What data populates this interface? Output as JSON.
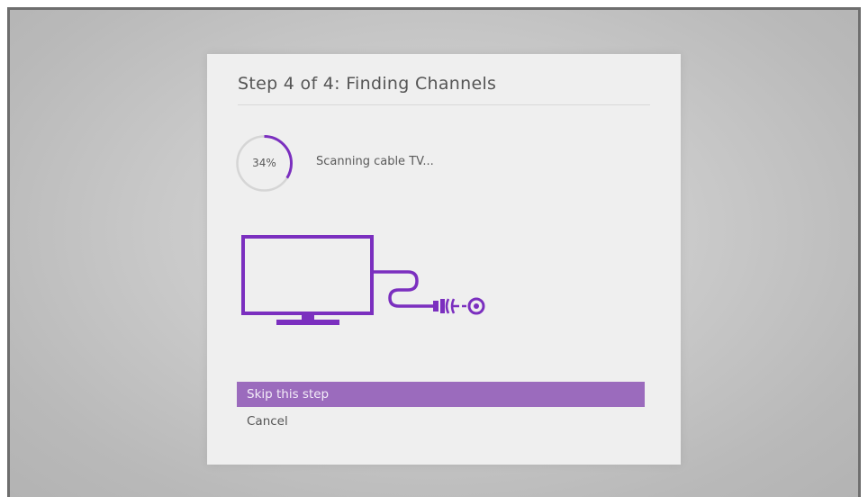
{
  "dialog": {
    "title": "Step 4 of 4: Finding Channels",
    "progress": {
      "percent_label": "34%",
      "value": 0.34,
      "status_text": "Scanning cable TV..."
    },
    "illustration": {
      "icons": [
        "tv-icon",
        "cable-icon",
        "coax-connector-icon"
      ]
    },
    "menu": [
      {
        "label": "Skip this step",
        "selected": true
      },
      {
        "label": "Cancel",
        "selected": false
      }
    ]
  },
  "colors": {
    "accent": "#7b2fbf",
    "selected_bg": "#9b6bbd",
    "dialog_bg": "#efefef",
    "ring_track": "#d5d5d5",
    "text": "#555555"
  }
}
